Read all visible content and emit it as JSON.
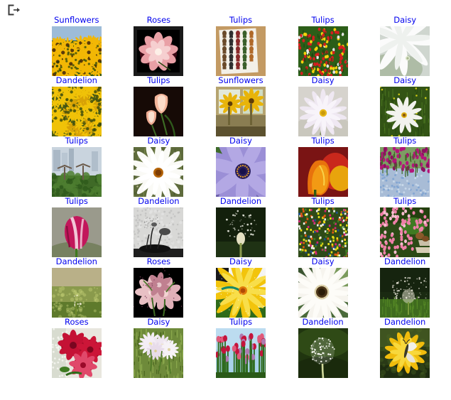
{
  "toolbar": {
    "export_icon_name": "export-icon",
    "export_icon_title": "Export"
  },
  "theme": {
    "link_color": "#0000ee",
    "background": "#ffffff"
  },
  "grid": {
    "columns": 5,
    "rows": 6,
    "thumb_size_px": 70,
    "items": [
      {
        "label": "Sunflowers",
        "thumb": "sunflower-field"
      },
      {
        "label": "Roses",
        "thumb": "pink-rose-black-frame"
      },
      {
        "label": "Tulips",
        "thumb": "tulip-sticker-sheet"
      },
      {
        "label": "Tulips",
        "thumb": "red-tulip-field"
      },
      {
        "label": "Daisy",
        "thumb": "white-daisy-dewdrop"
      },
      {
        "label": "Dandelion",
        "thumb": "yellow-dandelion-cluster"
      },
      {
        "label": "Tulips",
        "thumb": "peach-tulips-dark"
      },
      {
        "label": "Sunflowers",
        "thumb": "sunflowers-window"
      },
      {
        "label": "Daisy",
        "thumb": "white-daisy-yellow-center"
      },
      {
        "label": "Daisy",
        "thumb": "daisy-in-grass"
      },
      {
        "label": "Tulips",
        "thumb": "supertree-grove"
      },
      {
        "label": "Daisy",
        "thumb": "daisy-meadow"
      },
      {
        "label": "Daisy",
        "thumb": "purple-osteospermum"
      },
      {
        "label": "Tulips",
        "thumb": "orange-tulip-closeup"
      },
      {
        "label": "Tulips",
        "thumb": "magenta-tulip-bed"
      },
      {
        "label": "Tulips",
        "thumb": "pink-striped-tulip"
      },
      {
        "label": "Dandelion",
        "thumb": "dandelion-bw"
      },
      {
        "label": "Dandelion",
        "thumb": "dandelion-seedhead-dark"
      },
      {
        "label": "Tulips",
        "thumb": "flower-market"
      },
      {
        "label": "Tulips",
        "thumb": "pink-tulip-garden-steps"
      },
      {
        "label": "Dandelion",
        "thumb": "dandelion-field-bokeh"
      },
      {
        "label": "Roses",
        "thumb": "roses-black-background"
      },
      {
        "label": "Daisy",
        "thumb": "yellow-daisy-closeup"
      },
      {
        "label": "Daisy",
        "thumb": "white-gerbera"
      },
      {
        "label": "Dandelion",
        "thumb": "dandelion-blowing-grass"
      },
      {
        "label": "Roses",
        "thumb": "red-roses-bouquet"
      },
      {
        "label": "Daisy",
        "thumb": "english-daisies-lawn"
      },
      {
        "label": "Tulips",
        "thumb": "tulips-blue-sky"
      },
      {
        "label": "Dandelion",
        "thumb": "dandelion-puffball"
      },
      {
        "label": "Dandelion",
        "thumb": "butterfly-on-dandelion"
      }
    ]
  }
}
